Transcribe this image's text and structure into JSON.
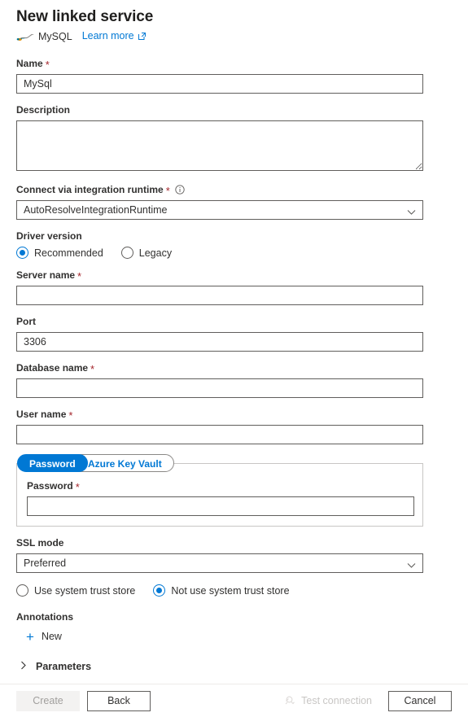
{
  "header": {
    "title": "New linked service",
    "connector_name": "MySQL",
    "logo_icon": "mysql-dolphin-icon",
    "learn_more_label": "Learn more",
    "learn_more_icon": "external-link-icon"
  },
  "form": {
    "name": {
      "label": "Name",
      "required_marker": "*",
      "value": "MySql",
      "placeholder": ""
    },
    "description": {
      "label": "Description",
      "value": "",
      "placeholder": ""
    },
    "integration_runtime": {
      "label": "Connect via integration runtime",
      "required_marker": "*",
      "info_icon": "info-icon",
      "value": "AutoResolveIntegrationRuntime",
      "chevron_icon": "chevron-down-icon"
    },
    "driver_version": {
      "label": "Driver version",
      "options": [
        {
          "label": "Recommended",
          "selected": true
        },
        {
          "label": "Legacy",
          "selected": false
        }
      ]
    },
    "server_name": {
      "label": "Server name",
      "required_marker": "*",
      "value": "",
      "placeholder": ""
    },
    "port": {
      "label": "Port",
      "value": "3306",
      "placeholder": ""
    },
    "database_name": {
      "label": "Database name",
      "required_marker": "*",
      "value": "",
      "placeholder": ""
    },
    "user_name": {
      "label": "User name",
      "required_marker": "*",
      "value": "",
      "placeholder": ""
    },
    "auth": {
      "tabs": [
        {
          "label": "Password",
          "selected": true
        },
        {
          "label": "Azure Key Vault",
          "selected": false
        }
      ],
      "password": {
        "label": "Password",
        "required_marker": "*",
        "value": "",
        "placeholder": ""
      }
    },
    "ssl_mode": {
      "label": "SSL mode",
      "value": "Preferred",
      "chevron_icon": "chevron-down-icon"
    },
    "trust_store": {
      "options": [
        {
          "label": "Use system trust store",
          "selected": false
        },
        {
          "label": "Not use system trust store",
          "selected": true
        }
      ]
    },
    "annotations": {
      "label": "Annotations",
      "new_label": "New",
      "plus_icon": "plus-icon"
    },
    "parameters": {
      "label": "Parameters",
      "chevron_icon": "chevron-right-icon",
      "expanded": false
    }
  },
  "footer": {
    "create_label": "Create",
    "back_label": "Back",
    "test_connection_label": "Test connection",
    "test_connection_icon": "plug-icon",
    "cancel_label": "Cancel"
  },
  "colors": {
    "accent": "#0078d4",
    "required": "#a4262c",
    "text": "#323130",
    "border": "#605e5c",
    "disabled_text": "#a19f9d"
  }
}
